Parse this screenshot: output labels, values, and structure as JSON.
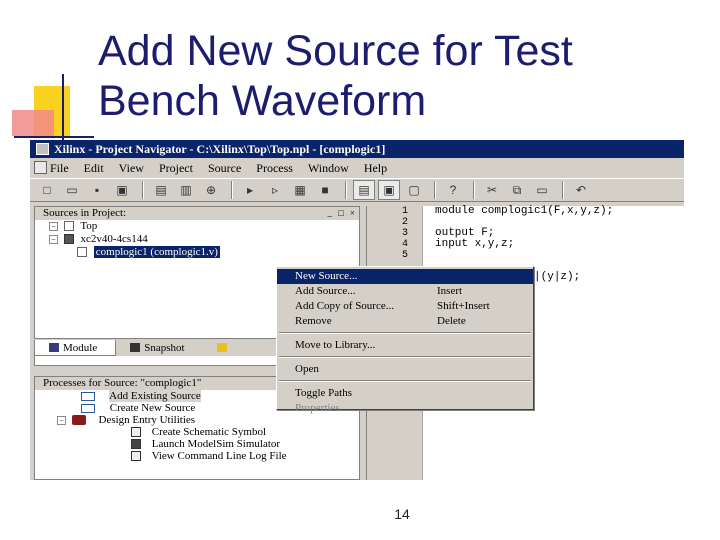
{
  "slide": {
    "title": "Add New Source for Test Bench Waveform",
    "page_number": "14"
  },
  "window": {
    "title": "Xilinx - Project Navigator - C:\\Xilinx\\Top\\Top.npl - [complogic1]"
  },
  "menubar": [
    "File",
    "Edit",
    "View",
    "Project",
    "Source",
    "Process",
    "Window",
    "Help"
  ],
  "sources": {
    "header": "Sources in Project:",
    "tree": [
      "Top",
      "xc2v40-4cs144",
      "complogic1 (complogic1.v)"
    ],
    "tabs": [
      "Module",
      "Snapshot"
    ]
  },
  "processes": {
    "header": "Processes for Source: \"complogic1\"",
    "items": [
      "Add Existing Source",
      "Create New Source",
      "Design Entry Utilities",
      "Create Schematic Symbol",
      "Launch ModelSim Simulator",
      "View Command Line Log File"
    ]
  },
  "editor": {
    "line_numbers": [
      "1",
      "2",
      "3",
      "4",
      "5"
    ],
    "code_lines": [
      "module complogic1(F,x,y,z);",
      "",
      "output F;",
      "input x,y,z;",
      "",
      "",
      "       (x & ~y)|(y|z);"
    ]
  },
  "context_menu": {
    "items": [
      {
        "label": "New Source...",
        "shortcut": "",
        "highlighted": true
      },
      {
        "label": "Add Source...",
        "shortcut": "Insert"
      },
      {
        "label": "Add Copy of Source...",
        "shortcut": "Shift+Insert"
      },
      {
        "label": "Remove",
        "shortcut": "Delete"
      },
      {
        "label": "Move to Library...",
        "shortcut": ""
      },
      {
        "label": "Open",
        "shortcut": ""
      },
      {
        "label": "Toggle Paths",
        "shortcut": ""
      },
      {
        "label": "Properties...",
        "shortcut": "",
        "disabled": true
      }
    ]
  },
  "colors": {
    "title_text": "#1d1d6e",
    "titlebar": "#0a246a",
    "menu_highlight": "#0a246a",
    "deco_yellow": "#f8d21e",
    "deco_red": "#f08a8a"
  }
}
